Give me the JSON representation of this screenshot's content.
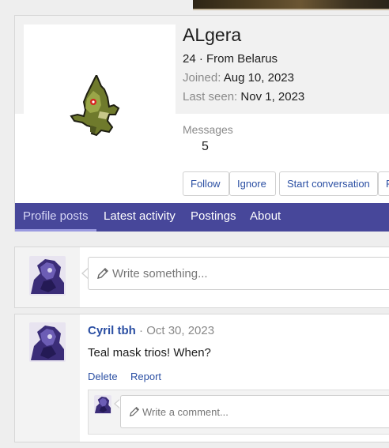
{
  "profile": {
    "username": "ALgera",
    "age_location": "24 · From Belarus",
    "joined_label": "Joined:",
    "joined_value": "Aug 10, 2023",
    "last_seen_label": "Last seen:",
    "last_seen_value": "Nov 1, 2023",
    "messages_label": "Messages",
    "messages_value": "5",
    "avatar_icon": "pokemon-sprite-icon"
  },
  "actions": {
    "follow": "Follow",
    "ignore": "Ignore",
    "start_conversation": "Start conversation",
    "more": "F"
  },
  "tabs": [
    {
      "label": "Profile posts",
      "active": true
    },
    {
      "label": "Latest activity",
      "active": false
    },
    {
      "label": "Postings",
      "active": false
    },
    {
      "label": "About",
      "active": false
    }
  ],
  "composer": {
    "placeholder": "Write something...",
    "icon": "pencil-icon"
  },
  "post": {
    "author": "Cyril tbh",
    "separator": " · ",
    "date": "Oct 30, 2023",
    "text": "Teal mask trios! When?",
    "delete_label": "Delete",
    "report_label": "Report",
    "comment_placeholder": "Write a comment..."
  },
  "colors": {
    "accent": "#47479a",
    "link": "#2b4fa3"
  }
}
